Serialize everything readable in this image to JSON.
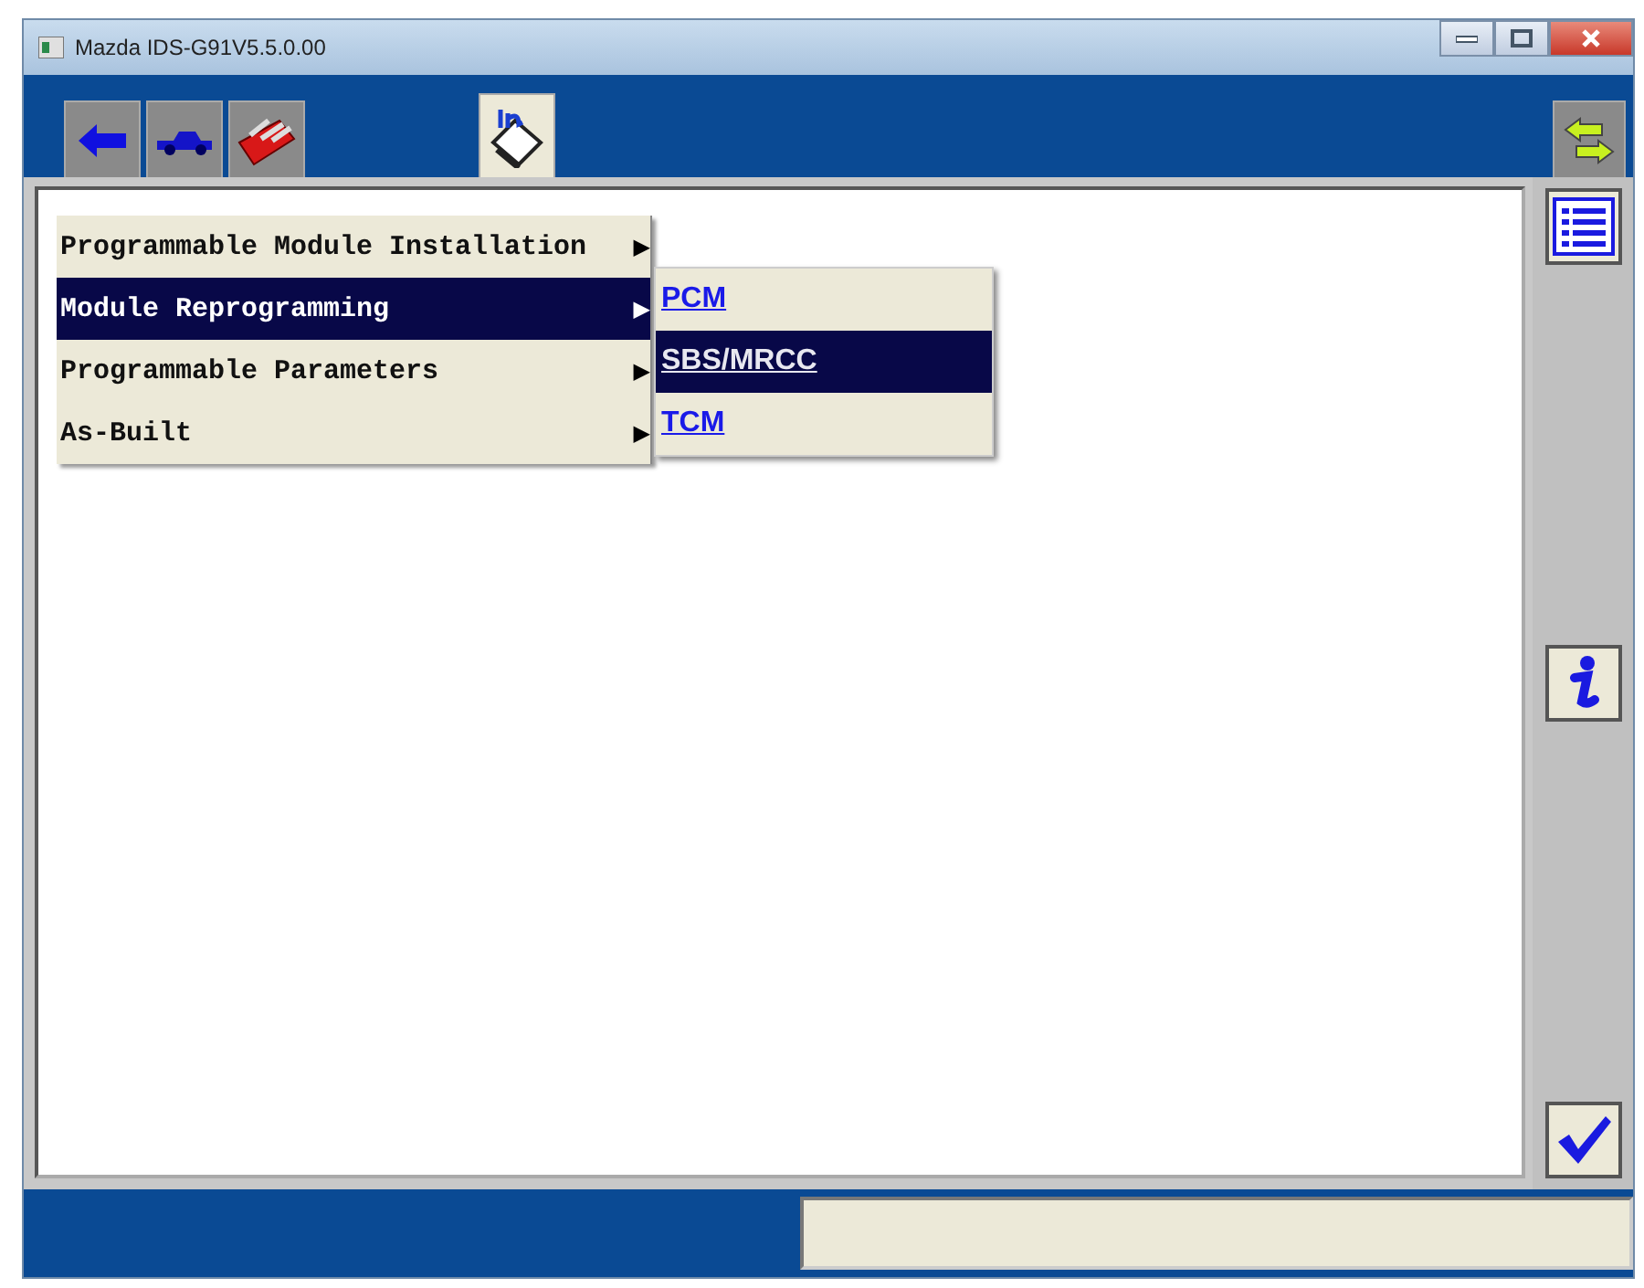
{
  "window": {
    "title": "Mazda IDS-G91V5.5.0.00"
  },
  "tabs": [
    {
      "kind": "back",
      "selected": false
    },
    {
      "kind": "vehicle",
      "selected": false
    },
    {
      "kind": "toolbox",
      "selected": false
    },
    {
      "kind": "info-book",
      "selected": true
    }
  ],
  "menu": [
    {
      "label": "Programmable Module Installation",
      "arrow": "▶",
      "selected": false
    },
    {
      "label": "Module Reprogramming",
      "arrow": "▶",
      "selected": true
    },
    {
      "label": "Programmable Parameters",
      "arrow": "▶",
      "selected": false
    },
    {
      "label": "As-Built",
      "arrow": "▶",
      "selected": false
    }
  ],
  "submenu": [
    {
      "label": "PCM",
      "selected": false
    },
    {
      "label": "SBS/MRCC",
      "selected": true
    },
    {
      "label": "TCM",
      "selected": false
    }
  ]
}
